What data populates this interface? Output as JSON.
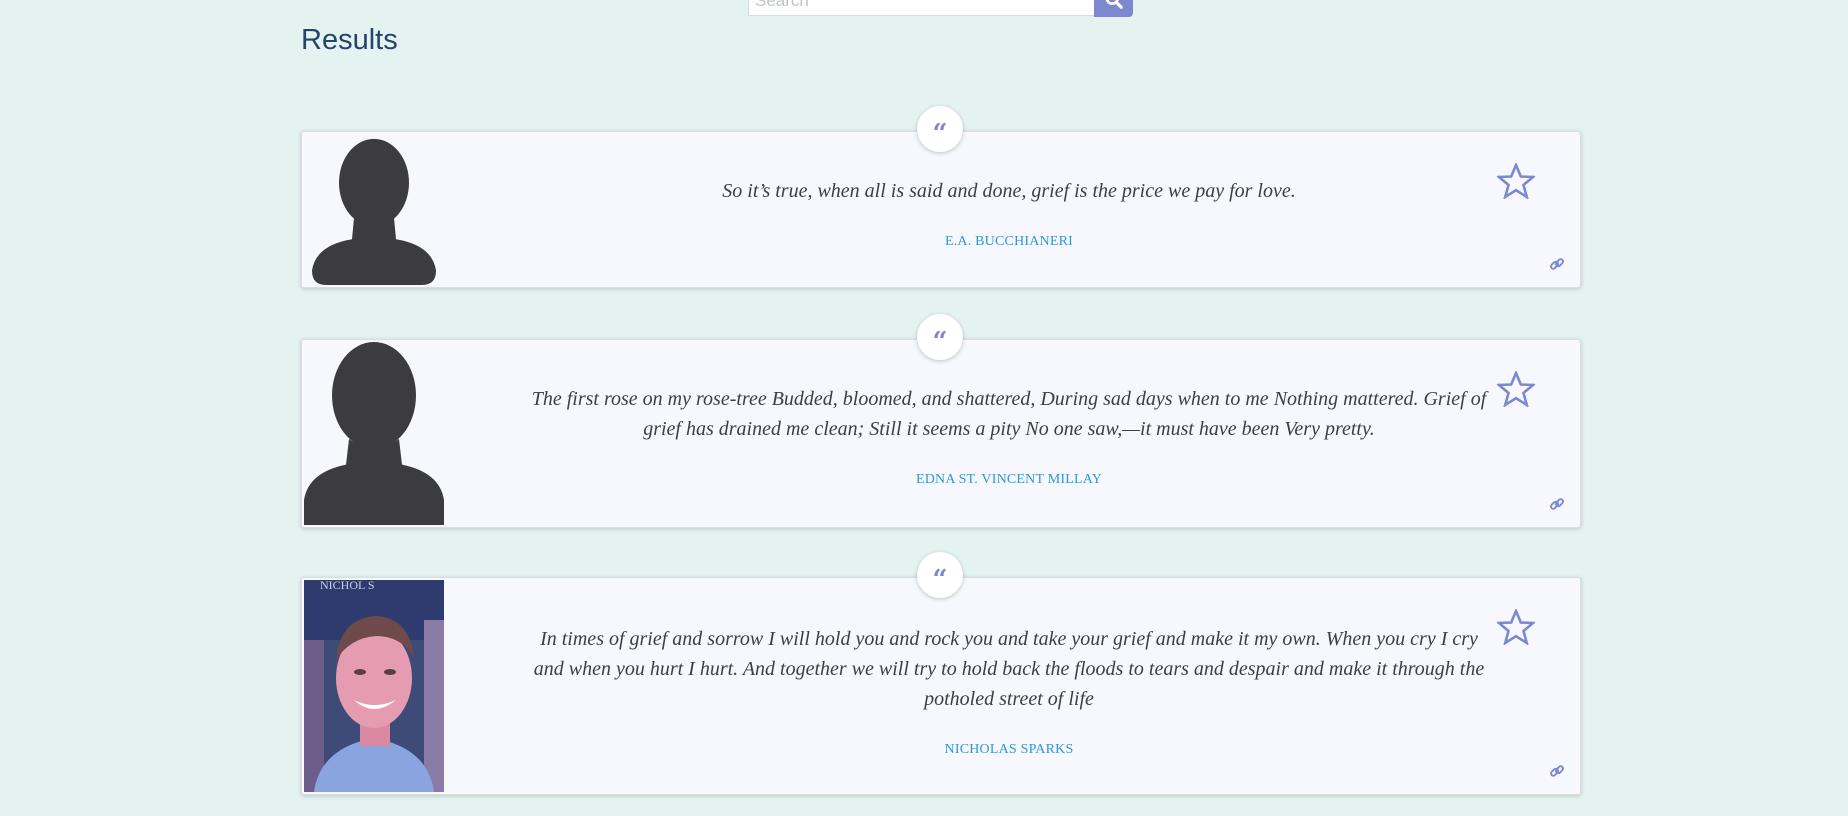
{
  "search": {
    "placeholder": "Search",
    "value": ""
  },
  "results_title": "Results",
  "colors": {
    "background": "#e4f3f0",
    "accent": "#7e88cf",
    "author_link": "#2b9ad4",
    "title": "#25436b"
  },
  "quotes": [
    {
      "badge": "“",
      "text": "So it’s true, when all is said and done, grief is the price we pay for love.",
      "author": "E.A. BUCCHIANERI",
      "avatar": "silhouette-placeholder"
    },
    {
      "badge": "“",
      "text": "The first rose on my rose-tree Budded, bloomed, and shattered, During sad days when to me Nothing mattered. Grief of grief has drained me clean; Still it seems a pity No one saw,—it must have been Very pretty.",
      "author": "EDNA ST. VINCENT MILLAY",
      "avatar": "silhouette-placeholder"
    },
    {
      "badge": "“",
      "text": "In times of grief and sorrow I will hold you and rock you and take your grief and make it my own. When you cry I cry and when you hurt I hurt. And together we will try to hold back the floods to tears and despair and make it through the potholed street of life",
      "author": "NICHOLAS SPARKS",
      "avatar": "author-photo",
      "photo_text": "NICHOL S"
    }
  ]
}
